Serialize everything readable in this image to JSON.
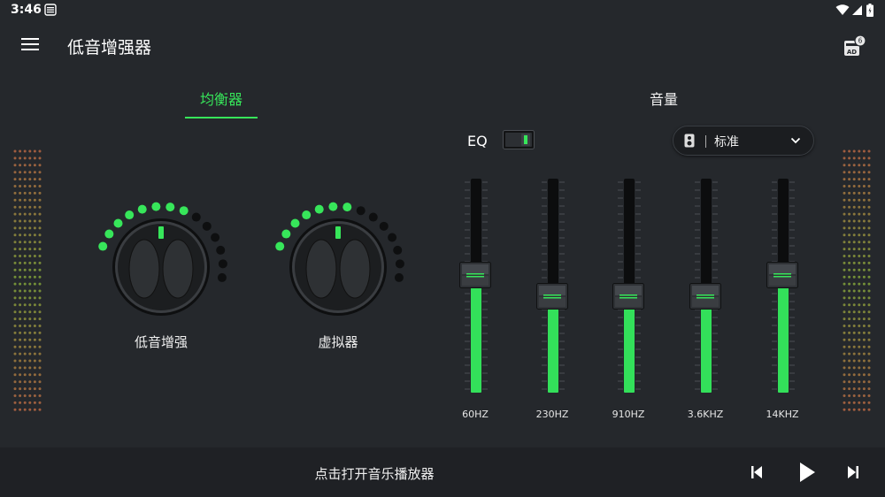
{
  "status_bar": {
    "time": "3:46"
  },
  "app_bar": {
    "title": "低音增强器"
  },
  "tabs": [
    {
      "label": "均衡器",
      "active": true
    },
    {
      "label": "音量",
      "active": false
    }
  ],
  "knobs": [
    {
      "label": "低音增强",
      "level_dots_on": 8,
      "level_dots_total": 14
    },
    {
      "label": "虚拟器",
      "level_dots_on": 7,
      "level_dots_total": 14
    }
  ],
  "eq": {
    "label": "EQ",
    "enabled": true,
    "preset": "标准",
    "bands": [
      {
        "freq": "60HZ",
        "level": 0.55
      },
      {
        "freq": "230HZ",
        "level": 0.45
      },
      {
        "freq": "910HZ",
        "level": 0.45
      },
      {
        "freq": "3.6KHZ",
        "level": 0.45
      },
      {
        "freq": "14KHZ",
        "level": 0.55
      }
    ]
  },
  "player": {
    "prompt": "点击打开音乐播放器"
  },
  "colors": {
    "accent": "#37e65a",
    "background": "#25282c",
    "bar": "#1f2125"
  }
}
